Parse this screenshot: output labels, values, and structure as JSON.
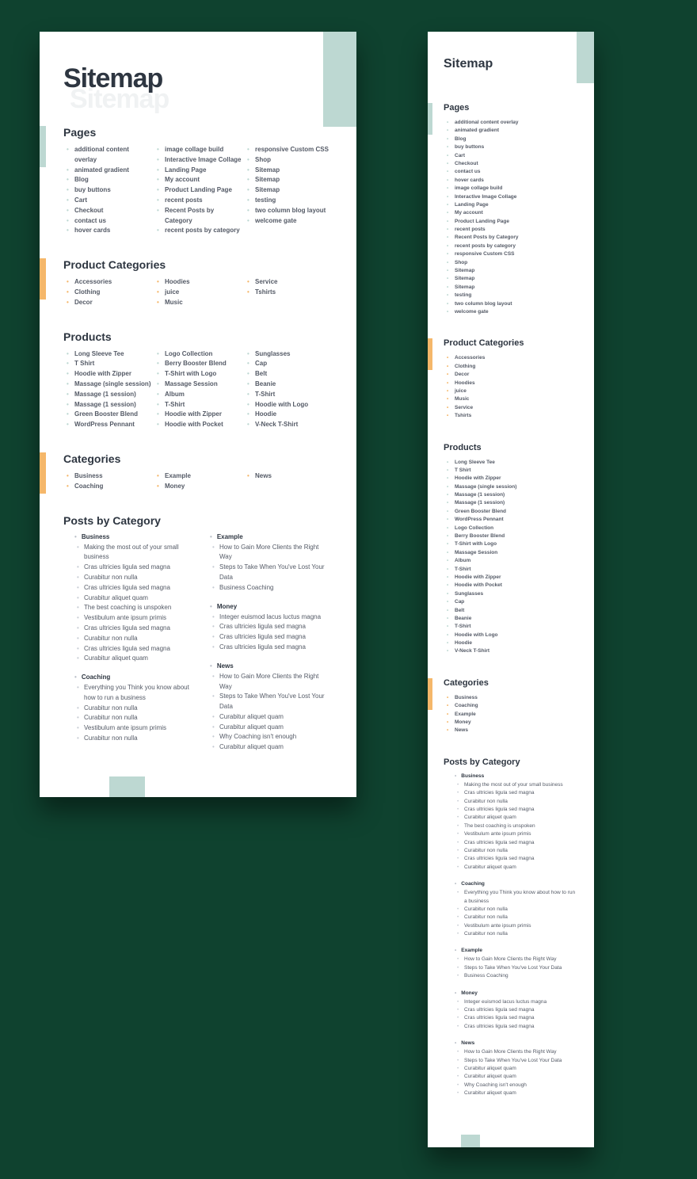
{
  "title": "Sitemap",
  "sections": {
    "pages": {
      "heading": "Pages",
      "accent": "teal",
      "items": [
        "additional content overlay",
        "animated gradient",
        "Blog",
        "buy buttons",
        "Cart",
        "Checkout",
        "contact us",
        "hover cards",
        "image collage build",
        "Interactive Image Collage",
        "Landing Page",
        "My account",
        "Product Landing Page",
        "recent posts",
        "Recent Posts by Category",
        "recent posts by category",
        "responsive Custom CSS",
        "Shop",
        "Sitemap",
        "Sitemap",
        "Sitemap",
        "testing",
        "two column blog layout",
        "welcome gate"
      ]
    },
    "product_categories": {
      "heading": "Product Categories",
      "accent": "orange",
      "items": [
        "Accessories",
        "Clothing",
        "Decor",
        "Hoodies",
        "juice",
        "Music",
        "Service",
        "Tshirts"
      ]
    },
    "products": {
      "heading": "Products",
      "accent": "teal",
      "items": [
        "Long Sleeve Tee",
        "T Shirt",
        "Hoodie with Zipper",
        "Massage (single session)",
        "Massage (1 session)",
        "Massage (1 session)",
        "Green Booster Blend",
        "WordPress Pennant",
        "Logo Collection",
        "Berry Booster Blend",
        "T-Shirt with Logo",
        "Massage Session",
        "Album",
        "T-Shirt",
        "Hoodie with Zipper",
        "Hoodie with Pocket",
        "Sunglasses",
        "Cap",
        "Belt",
        "Beanie",
        "T-Shirt",
        "Hoodie with Logo",
        "Hoodie",
        "V-Neck T-Shirt"
      ]
    },
    "categories": {
      "heading": "Categories",
      "accent": "orange",
      "items": [
        "Business",
        "Coaching",
        "Example",
        "Money",
        "News"
      ]
    },
    "posts_by_category": {
      "heading": "Posts by Category",
      "groups": [
        {
          "name": "Business",
          "posts": [
            "Making the most out of your small business",
            "Cras ultricies ligula sed magna",
            "Curabitur non nulla",
            "Cras ultricies ligula sed magna",
            "Curabitur aliquet quam",
            "The best coaching is unspoken",
            "Vestibulum ante ipsum primis",
            "Cras ultricies ligula sed magna",
            "Curabitur non nulla",
            "Cras ultricies ligula sed magna",
            "Curabitur aliquet quam"
          ]
        },
        {
          "name": "Coaching",
          "posts": [
            "Everything you Think you know about how to run a business",
            "Curabitur non nulla",
            "Curabitur non nulla",
            "Vestibulum ante ipsum primis",
            "Curabitur non nulla"
          ]
        },
        {
          "name": "Example",
          "posts": [
            "How to Gain More Clients the Right Way",
            "Steps to Take When You've Lost Your Data",
            "Business Coaching"
          ]
        },
        {
          "name": "Money",
          "posts": [
            "Integer euismod lacus luctus magna",
            "Cras ultricies ligula sed magna",
            "Cras ultricies ligula sed magna",
            "Cras ultricies ligula sed magna"
          ]
        },
        {
          "name": "News",
          "posts": [
            "How to Gain More Clients the Right Way",
            "Steps to Take When You've Lost Your Data",
            "Curabitur aliquet quam",
            "Curabitur aliquet quam",
            "Why Coaching isn't enough",
            "Curabitur aliquet quam"
          ]
        }
      ]
    }
  }
}
